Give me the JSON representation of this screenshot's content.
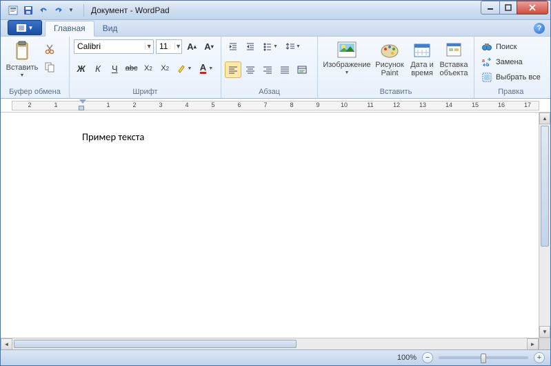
{
  "title": "Документ - WordPad",
  "tabs": {
    "home": "Главная",
    "view": "Вид"
  },
  "groups": {
    "clipboard": "Буфер обмена",
    "font": "Шрифт",
    "paragraph": "Абзац",
    "insert": "Вставить",
    "editing": "Правка"
  },
  "clipboard": {
    "paste": "Вставить"
  },
  "font": {
    "name": "Calibri",
    "size": "11"
  },
  "insert": {
    "image": "Изображение",
    "paint": "Рисунок\nPaint",
    "datetime": "Дата и\nвремя",
    "object": "Вставка\nобъекта"
  },
  "editing": {
    "find": "Поиск",
    "replace": "Замена",
    "selectall": "Выбрать все"
  },
  "document_text": "Пример текста",
  "status": {
    "zoom": "100%"
  },
  "ruler_marks": [
    -2,
    -1,
    1,
    2,
    3,
    4,
    5,
    6,
    7,
    8,
    9,
    10,
    11,
    12,
    13,
    14,
    15,
    16,
    17
  ]
}
